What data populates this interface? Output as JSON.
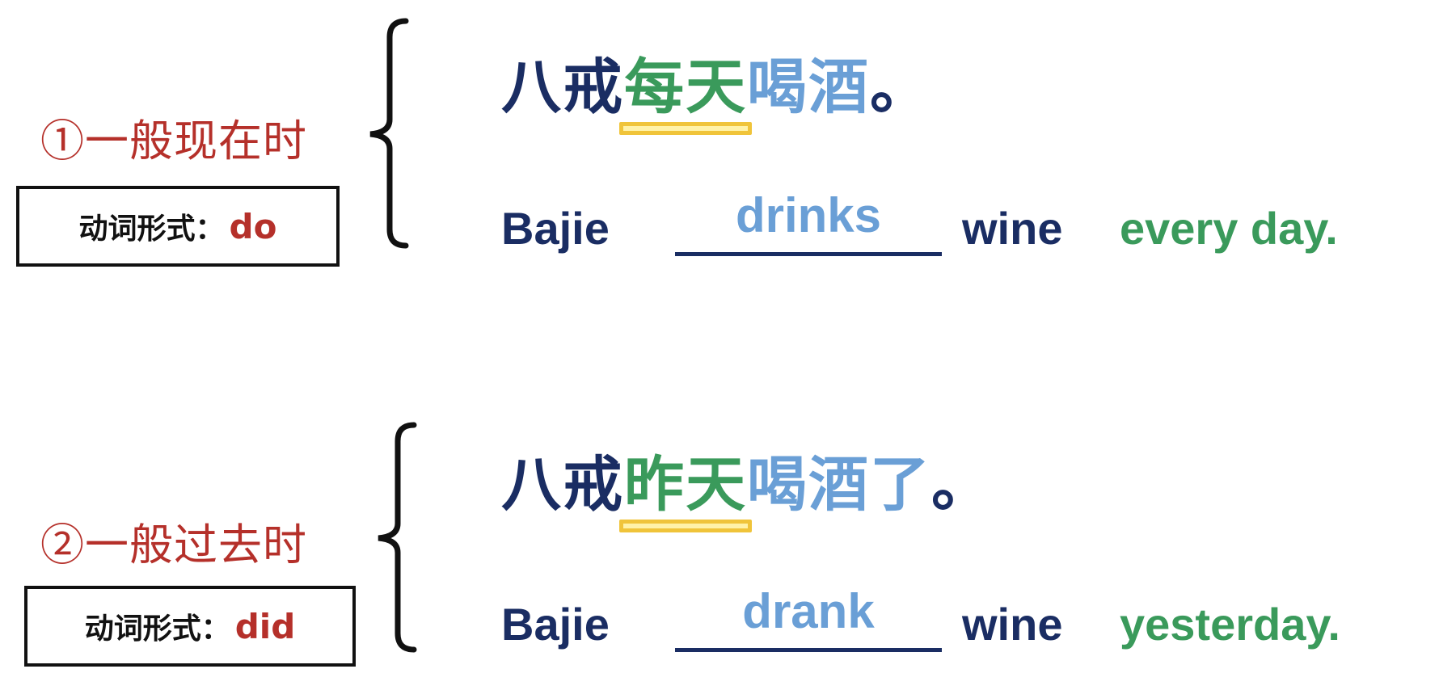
{
  "sections": [
    {
      "tense_label": "①一般现在时",
      "form_label": "动词形式：",
      "form_value": "do",
      "cn": {
        "subject": "八戒",
        "time": "每天",
        "verb": "喝酒",
        "tail": "",
        "end": "。"
      },
      "en": {
        "subject": "Bajie",
        "verb": "drinks",
        "object": "wine",
        "time": "every day."
      }
    },
    {
      "tense_label": "②一般过去时",
      "form_label": "动词形式：",
      "form_value": "did",
      "cn": {
        "subject": "八戒",
        "time": "昨天",
        "verb": "喝酒",
        "tail": "了",
        "end": "。"
      },
      "en": {
        "subject": "Bajie",
        "verb": "drank",
        "object": "wine",
        "time": "yesterday."
      }
    }
  ],
  "colors": {
    "label_red": "#b5302a",
    "dark_blue": "#1a2d63",
    "green": "#3a9a5b",
    "light_blue": "#6a9fd6",
    "underline_yellow": "#f0c43a"
  }
}
